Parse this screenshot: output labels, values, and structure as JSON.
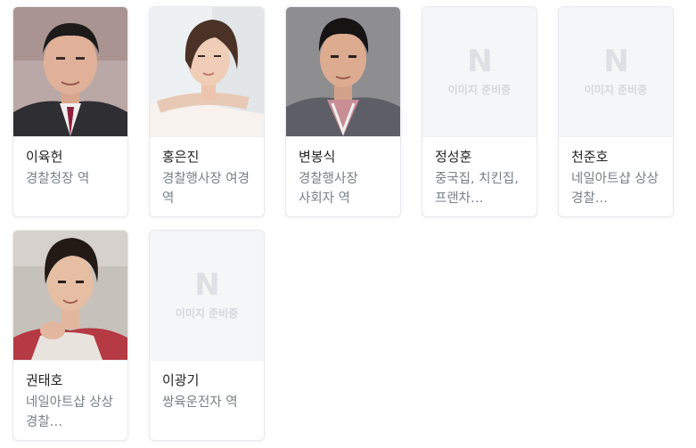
{
  "placeholder": {
    "logo": "N",
    "text": "이미지 준비중"
  },
  "cast": [
    {
      "name": "이육헌",
      "role": "경찰청장 역"
    },
    {
      "name": "홍은진",
      "role": "경찰행사장 여경 역"
    },
    {
      "name": "변봉식",
      "role": "경찰행사장 사회자 역"
    },
    {
      "name": "정성훈",
      "role": "중국집, 치킨집, 프랜차…"
    },
    {
      "name": "천준호",
      "role": "네일아트샵 상상 경찰…"
    },
    {
      "name": "권태호",
      "role": "네일아트샵 상상 경찰…"
    },
    {
      "name": "이광기",
      "role": "쌍육운전자 역"
    }
  ]
}
